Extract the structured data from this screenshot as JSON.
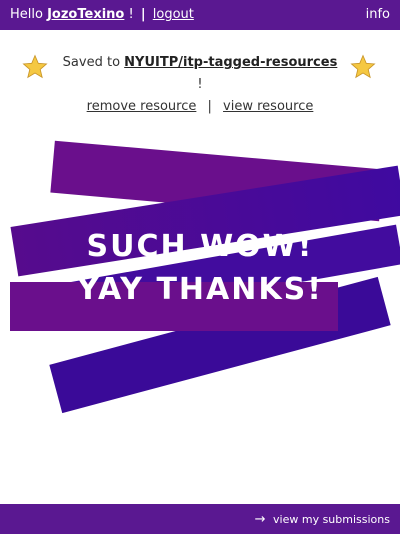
{
  "header": {
    "greeting": "Hello",
    "username": "JozoTexino",
    "exclaim": "!",
    "separator": "|",
    "logout_label": "logout",
    "info_label": "info"
  },
  "saved": {
    "prefix": "Saved to",
    "repo": "NYUITP/itp-tagged-resources",
    "suffix": "!",
    "remove_label": "remove resource",
    "divider": "|",
    "view_label": "view resource"
  },
  "celebration": {
    "line1": "SUCH WOW!",
    "line2": "YAY THANKS!"
  },
  "footer": {
    "arrow": "→",
    "link_label": "view my submissions"
  },
  "icons": {
    "star_left": "star-icon",
    "star_right": "star-icon",
    "arrow": "right-arrow-icon"
  },
  "colors": {
    "bar": "#5a1891",
    "accent": "#6a0f8c",
    "deep": "#3f0aa0",
    "star": "#f5c842"
  }
}
